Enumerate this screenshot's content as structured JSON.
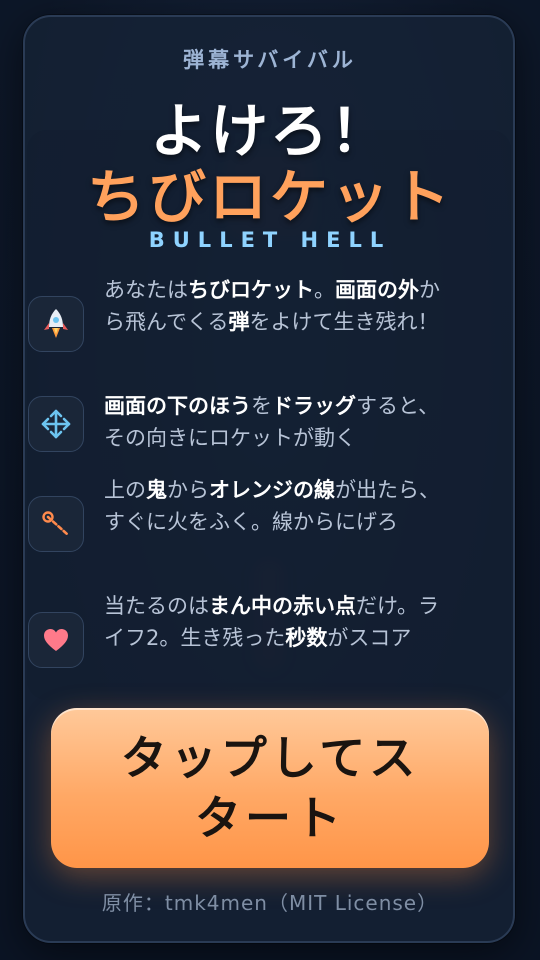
{
  "header": {
    "subtitle": "弾幕サバイバル",
    "title_line1": "よけろ！",
    "title_line2": "ちびロケット",
    "tagline": "BULLET HELL"
  },
  "rules": [
    {
      "icon": "rocket-icon",
      "parts": [
        {
          "t": "あなたは",
          "b": false
        },
        {
          "t": "ちびロケット",
          "b": true
        },
        {
          "t": "。",
          "b": false
        },
        {
          "t": "画面の外",
          "b": true
        },
        {
          "t": "から飛んでくる",
          "b": false
        },
        {
          "t": "弾",
          "b": true
        },
        {
          "t": "をよけて生き残れ！",
          "b": false
        }
      ]
    },
    {
      "icon": "move-arrows-icon",
      "parts": [
        {
          "t": "画面の下のほう",
          "b": true
        },
        {
          "t": "を",
          "b": false
        },
        {
          "t": "ドラッグ",
          "b": true
        },
        {
          "t": "すると、その向きにロケットが動く",
          "b": false
        }
      ]
    },
    {
      "icon": "laser-line-icon",
      "parts": [
        {
          "t": "上の",
          "b": false
        },
        {
          "t": "鬼",
          "b": true
        },
        {
          "t": "から",
          "b": false
        },
        {
          "t": "オレンジの線",
          "b": true
        },
        {
          "t": "が出たら、すぐに火をふく。線からにげろ",
          "b": false
        }
      ]
    },
    {
      "icon": "heart-icon",
      "parts": [
        {
          "t": "当たるのは",
          "b": false
        },
        {
          "t": "まん中の赤い点",
          "b": true
        },
        {
          "t": "だけ。ライフ2。生き残った",
          "b": false
        },
        {
          "t": "秒数",
          "b": true
        },
        {
          "t": "がスコア",
          "b": false
        }
      ]
    }
  ],
  "start_button": {
    "label": "タップしてスタート"
  },
  "credit": "原作：tmk4men（MIT License）",
  "colors": {
    "accent": "#ffa15c",
    "tagline": "#8fd3ff",
    "icon_blue": "#6cc4f0",
    "heart": "#ff7a8a"
  }
}
